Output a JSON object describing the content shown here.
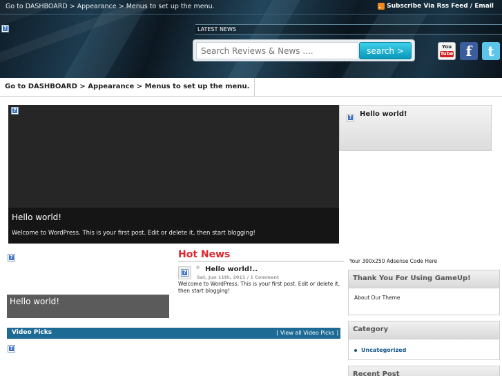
{
  "header": {
    "top_menu": "Go to DASHBOARD > Appearance > Menus to set up the menu.",
    "subscribe": "Subscribe Via Rss Feed / Email",
    "latest_news_label": "LATEST NEWS",
    "search": {
      "placeholder": "Search Reviews & News ....",
      "button_label": "search >"
    },
    "social": {
      "youtube_top": "You",
      "youtube_bottom": "Tube",
      "facebook": "f",
      "twitter": "t"
    }
  },
  "navbar": {
    "item": "Go to DASHBOARD > Appearance > Menus to set up the menu."
  },
  "slider": {
    "title": "Hello world!",
    "text": "Welcome to WordPress. This is your first post. Edit or delete it, then start blogging!"
  },
  "side_post": {
    "title": "Hello world!"
  },
  "left_column": {
    "title": "Hello world!"
  },
  "hot_news": {
    "heading": "Hot News",
    "post_title": "Hello world!..",
    "post_meta": "Sat, Jun 11th, 2011 / 1 Comment",
    "post_text": "Welcome to WordPress. This is your first post. Edit or delete it, then start blogging!"
  },
  "video_picks": {
    "label": "Video Picks",
    "view_all": "[ View all Video Picks ]"
  },
  "sidebar": {
    "ad_text": "Your 300x250 Adsense Code Here",
    "widgets": [
      {
        "title": "Thank You For Using GameUp!",
        "body": "About Our Theme"
      },
      {
        "title": "Category",
        "items": [
          "Uncategorized"
        ]
      },
      {
        "title": "Recent Post"
      }
    ]
  },
  "colors": {
    "hot_news": "#e0252c",
    "video_bar": "#1d6a94",
    "search_button": "#0897b9",
    "link": "#16578a"
  }
}
